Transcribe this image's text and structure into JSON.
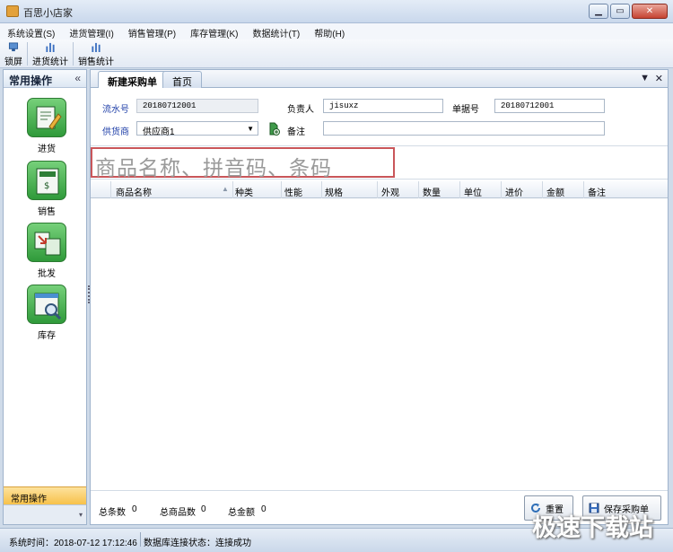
{
  "window": {
    "title": "百思小店家"
  },
  "menu": [
    "系统设置(S)",
    "进货管理(I)",
    "销售管理(P)",
    "库存管理(K)",
    "数据统计(T)",
    "帮助(H)"
  ],
  "toolbar": {
    "lock": "锁屏",
    "purchase_stats": "进货统计",
    "sales_stats": "销售统计"
  },
  "sidebar": {
    "title": "常用操作",
    "items": [
      {
        "label": "进货",
        "icon": "edit-document-icon"
      },
      {
        "label": "销售",
        "icon": "cash-register-icon"
      },
      {
        "label": "批发",
        "icon": "transfer-icon"
      },
      {
        "label": "库存",
        "icon": "inventory-search-icon"
      }
    ],
    "footer": "常用操作"
  },
  "tabs": [
    {
      "label": "新建采购单",
      "active": true
    },
    {
      "label": "首页",
      "active": false
    }
  ],
  "form": {
    "serial_label": "流水号",
    "serial_value": "20180712001",
    "owner_label": "负责人",
    "owner_value": "jisuxz",
    "receipt_label": "单据号",
    "receipt_value": "20180712001",
    "supplier_label": "供货商",
    "supplier_value": "供应商1",
    "remark_label": "备注",
    "remark_value": ""
  },
  "search": {
    "placeholder": "商品名称、拼音码、条码"
  },
  "grid": {
    "columns": [
      "商品名称",
      "种类",
      "性能",
      "规格",
      "外观",
      "数量",
      "单位",
      "进价",
      "金额",
      "备注"
    ]
  },
  "totals": {
    "count_label": "总条数",
    "count_value": "0",
    "items_label": "总商品数",
    "items_value": "0",
    "amount_label": "总金额",
    "amount_value": "0"
  },
  "buttons": {
    "reset": "重置",
    "save": "保存采购单"
  },
  "status": {
    "time": "系统时间：2018-07-12 17:12:46",
    "db": "数据库连接状态：连接成功"
  },
  "watermark": "极速下载站",
  "colors": {
    "accent_green": "#2f9a3a",
    "search_border": "#c9565a",
    "label_blue": "#1f3fa8"
  }
}
